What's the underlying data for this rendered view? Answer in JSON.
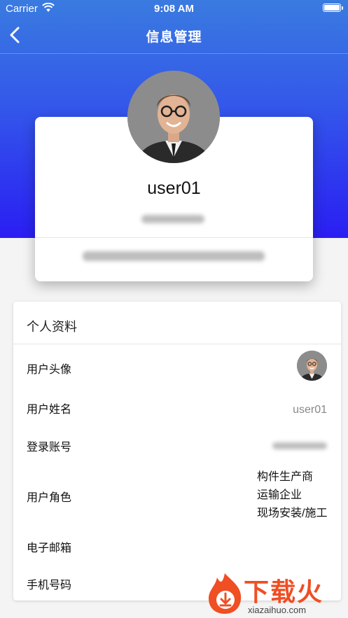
{
  "status_bar": {
    "carrier": "Carrier",
    "time": "9:08 AM"
  },
  "nav": {
    "title": "信息管理"
  },
  "profile": {
    "username": "user01"
  },
  "info": {
    "section_title": "个人资料",
    "rows": {
      "avatar_label": "用户头像",
      "name_label": "用户姓名",
      "name_value": "user01",
      "account_label": "登录账号",
      "role_label": "用户角色",
      "roles": [
        "构件生产商",
        "运输企业",
        "现场安装/施工"
      ],
      "email_label": "电子邮箱",
      "phone_label": "手机号码"
    }
  },
  "watermark": {
    "brand": "下载火",
    "url": "xiazaihuo.com"
  },
  "colors": {
    "gradient_top": "#3a7be0",
    "gradient_bottom": "#2a1ef3",
    "watermark_orange": "#f04e23"
  }
}
